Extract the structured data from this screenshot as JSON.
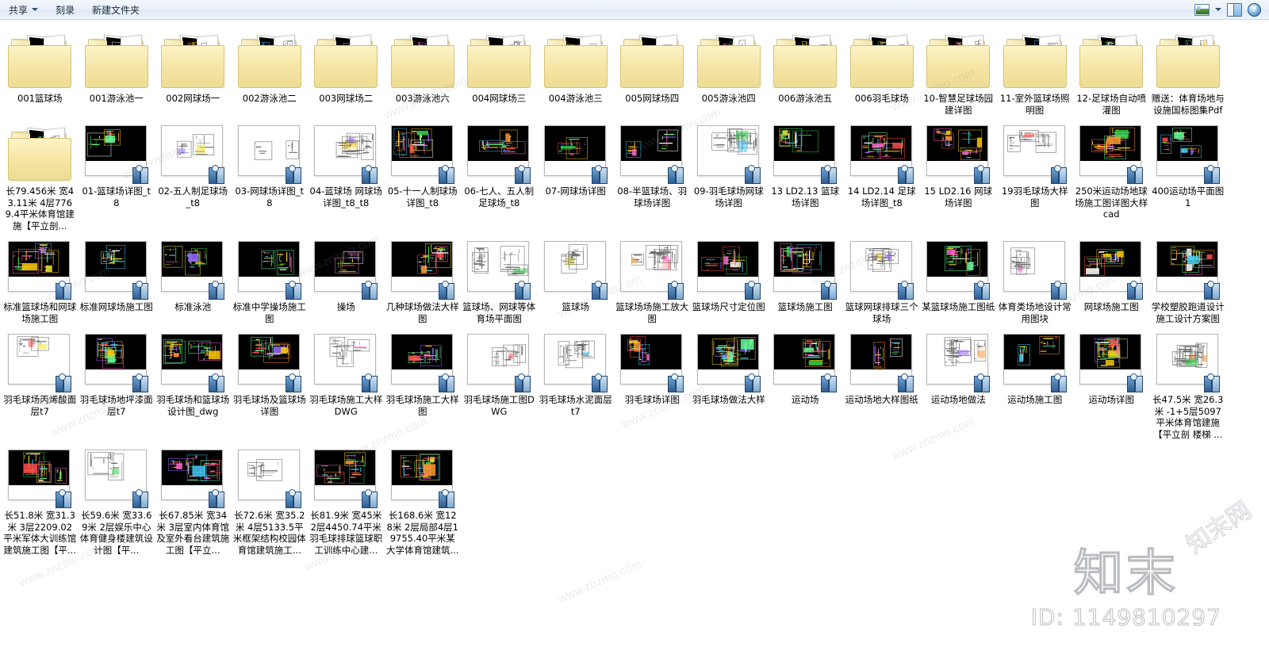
{
  "toolbar": {
    "share_label": "共享",
    "burn_label": "刻录",
    "new_folder_label": "新建文件夹",
    "view_icon": "view-mode-icon",
    "caret_icon": "chevron-down-icon",
    "pane_icon": "preview-pane-icon",
    "help_icon": "help-icon",
    "help_glyph": "?"
  },
  "watermark": {
    "brand": "知末",
    "id": "ID: 1149810297",
    "diagonal": "知末网",
    "tiles": [
      "www.znzmo.com",
      "www.znzmo.com",
      "znzmo.com",
      "www.znzmo.com",
      "www.znzmo.com"
    ]
  },
  "items": [
    {
      "name": "001篮球场",
      "type": "folder",
      "preview": "dark-cad"
    },
    {
      "name": "001游泳池一",
      "type": "folder",
      "preview": "light-cad"
    },
    {
      "name": "002网球场一",
      "type": "folder",
      "preview": "white-cad"
    },
    {
      "name": "002游泳池二",
      "type": "folder",
      "preview": "color-cad"
    },
    {
      "name": "003网球场二",
      "type": "folder",
      "preview": "dark-cad"
    },
    {
      "name": "003游泳池六",
      "type": "folder",
      "preview": "dark-cad"
    },
    {
      "name": "004网球场三",
      "type": "folder",
      "preview": "light-cad"
    },
    {
      "name": "004游泳池三",
      "type": "folder",
      "preview": "white-cad"
    },
    {
      "name": "005网球场四",
      "type": "folder",
      "preview": "dark-cad"
    },
    {
      "name": "005游泳池四",
      "type": "folder",
      "preview": "light-cad"
    },
    {
      "name": "006游泳池五",
      "type": "folder",
      "preview": "light-cad"
    },
    {
      "name": "006羽毛球场",
      "type": "folder",
      "preview": "dark-cad"
    },
    {
      "name": "10-智慧足球场园建详图",
      "type": "folder",
      "preview": "tm-cad"
    },
    {
      "name": "11-室外篮球场照明图",
      "type": "folder",
      "preview": "dark-cad"
    },
    {
      "name": "12-足球场自动喷灌图",
      "type": "folder",
      "preview": "dark-cad"
    },
    {
      "name": "赠送：体育场地与设施国标图集Pdf",
      "type": "folder",
      "preview": "red-cad"
    },
    {
      "name": "长79.456米 宽43.11米 4层7769.4平米体育馆建施【平立剖...",
      "type": "folder",
      "preview": "white-cad"
    },
    {
      "name": "01-篮球场详图_t8",
      "type": "file",
      "preview": "cad-green"
    },
    {
      "name": "02-五人制足球场_t8",
      "type": "file",
      "preview": "cad-green"
    },
    {
      "name": "03-网球场详图_t8",
      "type": "file",
      "preview": "cad-green"
    },
    {
      "name": "04-蓝球场 网球场详图_t8_t8",
      "type": "file",
      "preview": "cad-color"
    },
    {
      "name": "05-十一人制球场详图_t8",
      "type": "file",
      "preview": "cad-green"
    },
    {
      "name": "06-七人、五人制足球场_t8",
      "type": "file",
      "preview": "cad-green"
    },
    {
      "name": "07-网球场详图",
      "type": "file",
      "preview": "cad-white"
    },
    {
      "name": "08-半篮球场、羽球场详图",
      "type": "file",
      "preview": "cad-white2"
    },
    {
      "name": "09-羽毛球场网球场详图",
      "type": "file",
      "preview": "cad-color"
    },
    {
      "name": "13 LD2.13 篮球场详图",
      "type": "file",
      "preview": "cad-dark"
    },
    {
      "name": "14 LD2.14 足球场详图_t8",
      "type": "file",
      "preview": "cad-dark2"
    },
    {
      "name": "15 LD2.16 网球场详图",
      "type": "file",
      "preview": "cad-green2"
    },
    {
      "name": "19羽毛球场大样图",
      "type": "file",
      "preview": "cad-color2"
    },
    {
      "name": "250米运动场地球场施工图详图大样cad",
      "type": "file",
      "preview": "cad-color3"
    },
    {
      "name": "400运动场平面图1",
      "type": "file",
      "preview": "cad-white3"
    },
    {
      "name": "标准篮球场和网球场施工图",
      "type": "file",
      "preview": "cad-ltblue"
    },
    {
      "name": "标准网球场施工图",
      "type": "file",
      "preview": "cad-color4"
    },
    {
      "name": "标准泳池",
      "type": "file",
      "preview": "cad-red"
    },
    {
      "name": "标准中学操场施工图",
      "type": "file",
      "preview": "cad-plan"
    },
    {
      "name": "操场",
      "type": "file",
      "preview": "cad-plan2"
    },
    {
      "name": "几种球场做法大样图",
      "type": "file",
      "preview": "cad-color5"
    },
    {
      "name": "篮球场、网球等体育场平面图",
      "type": "file",
      "preview": "cad-dark3"
    },
    {
      "name": "篮球场",
      "type": "file",
      "preview": "cad-line"
    },
    {
      "name": "篮球场场施工放大图",
      "type": "file",
      "preview": "cad-color6"
    },
    {
      "name": "篮球场尺寸定位图",
      "type": "file",
      "preview": "cad-court"
    },
    {
      "name": "篮球场施工图",
      "type": "file",
      "preview": "cad-dark4"
    },
    {
      "name": "篮球网球排球三个球场",
      "type": "file",
      "preview": "cad-color7"
    },
    {
      "name": "某篮球场施工图纸",
      "type": "file",
      "preview": "cad-green3"
    },
    {
      "name": "体育类场地设计常用图块",
      "type": "file",
      "preview": "cad-blocks"
    },
    {
      "name": "网球场施工图",
      "type": "file",
      "preview": "cad-color8"
    },
    {
      "name": "学校塑胶跑道设计施工设计方案图",
      "type": "file",
      "preview": "cad-track"
    },
    {
      "name": "羽毛球场丙烯酸面层t7",
      "type": "file",
      "preview": "cad-color9"
    },
    {
      "name": "羽毛球场地坪漆面层t7",
      "type": "file",
      "preview": "cad-pink"
    },
    {
      "name": "羽毛球场和篮球场设计图_dwg",
      "type": "file",
      "preview": "cad-dark5"
    },
    {
      "name": "羽毛球场及篮球场详图",
      "type": "file",
      "preview": "cad-white4"
    },
    {
      "name": "羽毛球场施工大样DWG",
      "type": "file",
      "preview": "cad-gray"
    },
    {
      "name": "羽毛球场施工大样图",
      "type": "file",
      "preview": "cad-gray2"
    },
    {
      "name": "羽毛球场施工图DWG",
      "type": "file",
      "preview": "cad-elev"
    },
    {
      "name": "羽毛球场水泥面层t7",
      "type": "file",
      "preview": "cad-color10"
    },
    {
      "name": "羽毛球场详图",
      "type": "file",
      "preview": "cad-small"
    },
    {
      "name": "羽毛球场做法大样",
      "type": "file",
      "preview": "cad-cyan"
    },
    {
      "name": "运动场",
      "type": "file",
      "preview": "cad-elev2"
    },
    {
      "name": "运动场地大样图纸",
      "type": "file",
      "preview": "cad-color11"
    },
    {
      "name": "运动场地做法",
      "type": "file",
      "preview": "cad-cyan2"
    },
    {
      "name": "运动场施工图",
      "type": "file",
      "preview": "cad-dark6"
    },
    {
      "name": "运动场详图",
      "type": "file",
      "preview": "cad-color12"
    },
    {
      "name": "长47.5米 宽26.3米 -1+5层5097平米体育馆建施【平立剖 楼梯 ...",
      "type": "file",
      "preview": "cad-green4"
    },
    {
      "name": "长51.8米 宽31.3米 3层2209.02平米军体大训练馆建筑施工图【平...",
      "type": "file",
      "preview": "cad-color13"
    },
    {
      "name": "长59.6米 宽33.69米 2层娱乐中心体育健身楼建筑设计图【平...",
      "type": "file",
      "preview": "cad-color14"
    },
    {
      "name": "长67.85米 宽34米 3层室内体育馆及室外看台建筑施工图【平立...",
      "type": "file",
      "preview": "cad-dark7"
    },
    {
      "name": "长72.6米 宽35.2米 4层5133.5平米框架结构校园体育馆建筑施工...",
      "type": "file",
      "preview": "cad-color15"
    },
    {
      "name": "长81.9米 宽45米 2层4450.74平米羽毛球排球篮球职工训练中心建...",
      "type": "file",
      "preview": "cad-color16"
    },
    {
      "name": "长168.6米 宽128米 2层局部4层19755.40平米某大学体育馆建筑...",
      "type": "file",
      "preview": "cad-color17"
    }
  ]
}
